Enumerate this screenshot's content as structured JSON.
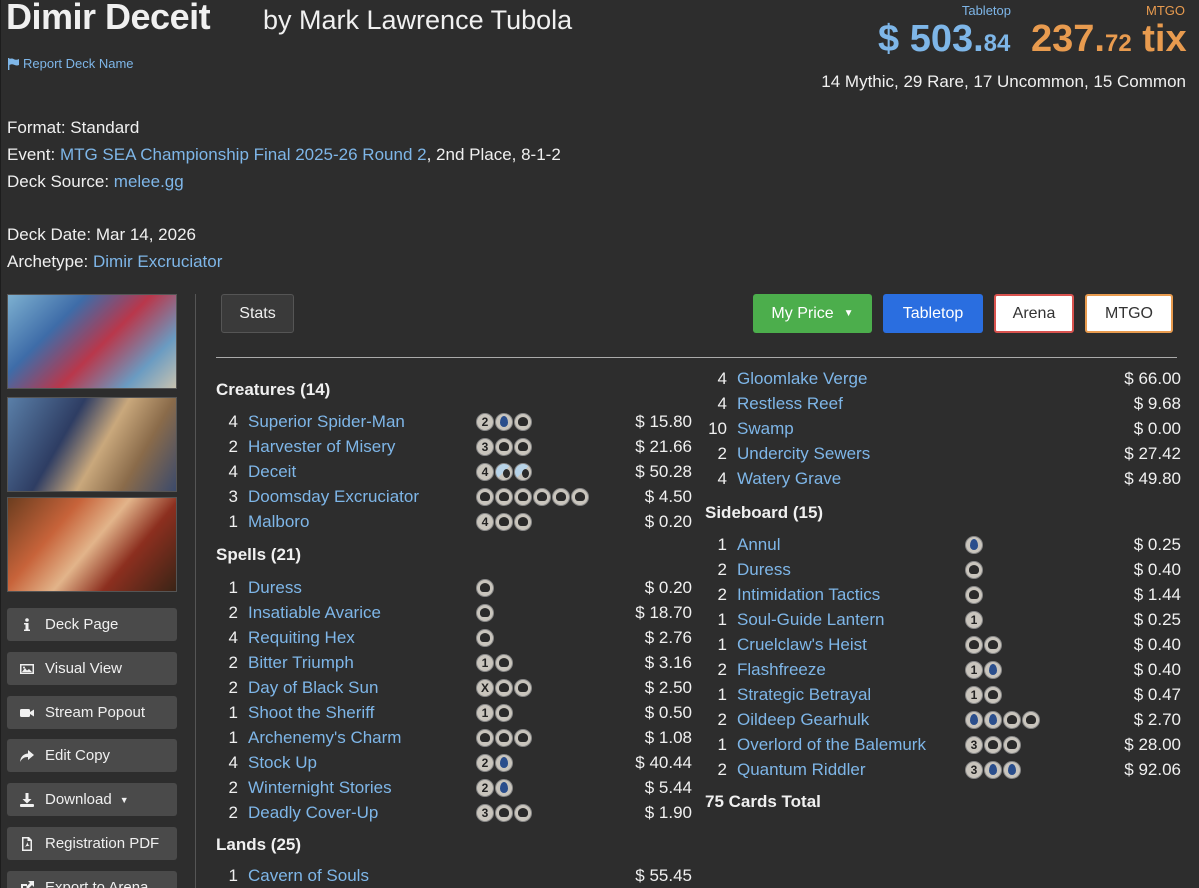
{
  "header": {
    "title": "Dimir Deceit",
    "author": "by Mark Lawrence Tubola",
    "report_link": "Report Deck Name"
  },
  "prices": {
    "tabletop_label": "Tabletop",
    "mtgo_label": "MTGO",
    "tabletop_whole": "$ 503.",
    "tabletop_cents": "84",
    "mtgo_whole": "237.",
    "mtgo_cents": "72",
    "mtgo_suffix": " tix",
    "rarity_summary": "14 Mythic, 29 Rare, 17 Uncommon, 15 Common"
  },
  "meta": {
    "format_label": "Format:",
    "format_value": "Standard",
    "event_label": "Event:",
    "event_link": "MTG SEA Championship Final 2025-26 Round 2",
    "event_rest": ", 2nd Place, 8-1-2",
    "source_label": "Deck Source:",
    "source_link": "melee.gg",
    "date_label": "Deck Date:",
    "date_value": "Mar 14, 2026",
    "archetype_label": "Archetype:",
    "archetype_link": "Dimir Excruciator"
  },
  "sidebar": {
    "buttons": [
      {
        "label": "Deck Page",
        "icon": "info-icon"
      },
      {
        "label": "Visual View",
        "icon": "image-icon"
      },
      {
        "label": "Stream Popout",
        "icon": "video-icon"
      },
      {
        "label": "Edit Copy",
        "icon": "share-icon"
      },
      {
        "label": "Download",
        "icon": "download-icon"
      },
      {
        "label": "Registration PDF",
        "icon": "pdf-icon"
      },
      {
        "label": "Export to Arena",
        "icon": "export-icon"
      }
    ]
  },
  "toolbar": {
    "stats": "Stats",
    "my_price": "My Price",
    "tabletop": "Tabletop",
    "arena": "Arena",
    "mtgo": "MTGO"
  },
  "sections": {
    "creatures": "Creatures (14)",
    "spells": "Spells (21)",
    "lands": "Lands (25)",
    "sideboard": "Sideboard (15)",
    "total": "75 Cards Total"
  },
  "creatures": [
    {
      "qty": "4",
      "name": "Superior Spider-Man",
      "mana": [
        "2",
        "u",
        "b"
      ],
      "price": "$ 15.80"
    },
    {
      "qty": "2",
      "name": "Harvester of Misery",
      "mana": [
        "3",
        "b",
        "b"
      ],
      "price": "$ 21.66"
    },
    {
      "qty": "4",
      "name": "Deceit",
      "mana": [
        "4",
        "ub",
        "ub"
      ],
      "price": "$ 50.28"
    },
    {
      "qty": "3",
      "name": "Doomsday Excruciator",
      "mana": [
        "b",
        "b",
        "b",
        "b",
        "b",
        "b"
      ],
      "price": "$ 4.50"
    },
    {
      "qty": "1",
      "name": "Malboro",
      "mana": [
        "4",
        "b",
        "b"
      ],
      "price": "$ 0.20"
    }
  ],
  "spells": [
    {
      "qty": "1",
      "name": "Duress",
      "mana": [
        "b"
      ],
      "price": "$ 0.20"
    },
    {
      "qty": "2",
      "name": "Insatiable Avarice",
      "mana": [
        "b"
      ],
      "price": "$ 18.70"
    },
    {
      "qty": "4",
      "name": "Requiting Hex",
      "mana": [
        "b"
      ],
      "price": "$ 2.76"
    },
    {
      "qty": "2",
      "name": "Bitter Triumph",
      "mana": [
        "1",
        "b"
      ],
      "price": "$ 3.16"
    },
    {
      "qty": "2",
      "name": "Day of Black Sun",
      "mana": [
        "X",
        "b",
        "b"
      ],
      "price": "$ 2.50"
    },
    {
      "qty": "1",
      "name": "Shoot the Sheriff",
      "mana": [
        "1",
        "b"
      ],
      "price": "$ 0.50"
    },
    {
      "qty": "1",
      "name": "Archenemy's Charm",
      "mana": [
        "b",
        "b",
        "b"
      ],
      "price": "$ 1.08"
    },
    {
      "qty": "4",
      "name": "Stock Up",
      "mana": [
        "2",
        "u"
      ],
      "price": "$ 40.44"
    },
    {
      "qty": "2",
      "name": "Winternight Stories",
      "mana": [
        "2",
        "u"
      ],
      "price": "$ 5.44"
    },
    {
      "qty": "2",
      "name": "Deadly Cover-Up",
      "mana": [
        "3",
        "b",
        "b"
      ],
      "price": "$ 1.90"
    }
  ],
  "lands_left": [
    {
      "qty": "1",
      "name": "Cavern of Souls",
      "price": "$ 55.45"
    }
  ],
  "lands_right": [
    {
      "qty": "4",
      "name": "Gloomlake Verge",
      "price": "$ 66.00"
    },
    {
      "qty": "4",
      "name": "Restless Reef",
      "price": "$ 9.68"
    },
    {
      "qty": "10",
      "name": "Swamp",
      "price": "$ 0.00"
    },
    {
      "qty": "2",
      "name": "Undercity Sewers",
      "price": "$ 27.42"
    },
    {
      "qty": "4",
      "name": "Watery Grave",
      "price": "$ 49.80"
    }
  ],
  "sideboard": [
    {
      "qty": "1",
      "name": "Annul",
      "mana": [
        "u"
      ],
      "price": "$ 0.25"
    },
    {
      "qty": "2",
      "name": "Duress",
      "mana": [
        "b"
      ],
      "price": "$ 0.40"
    },
    {
      "qty": "2",
      "name": "Intimidation Tactics",
      "mana": [
        "b"
      ],
      "price": "$ 1.44"
    },
    {
      "qty": "1",
      "name": "Soul-Guide Lantern",
      "mana": [
        "1"
      ],
      "price": "$ 0.25"
    },
    {
      "qty": "1",
      "name": "Cruelclaw's Heist",
      "mana": [
        "b",
        "b"
      ],
      "price": "$ 0.40"
    },
    {
      "qty": "2",
      "name": "Flashfreeze",
      "mana": [
        "1",
        "u"
      ],
      "price": "$ 0.40"
    },
    {
      "qty": "1",
      "name": "Strategic Betrayal",
      "mana": [
        "1",
        "b"
      ],
      "price": "$ 0.47"
    },
    {
      "qty": "2",
      "name": "Oildeep Gearhulk",
      "mana": [
        "u",
        "u",
        "b",
        "b"
      ],
      "price": "$ 2.70"
    },
    {
      "qty": "1",
      "name": "Overlord of the Balemurk",
      "mana": [
        "3",
        "b",
        "b"
      ],
      "price": "$ 28.00"
    },
    {
      "qty": "2",
      "name": "Quantum Riddler",
      "mana": [
        "3",
        "u",
        "u"
      ],
      "price": "$ 92.06"
    }
  ]
}
